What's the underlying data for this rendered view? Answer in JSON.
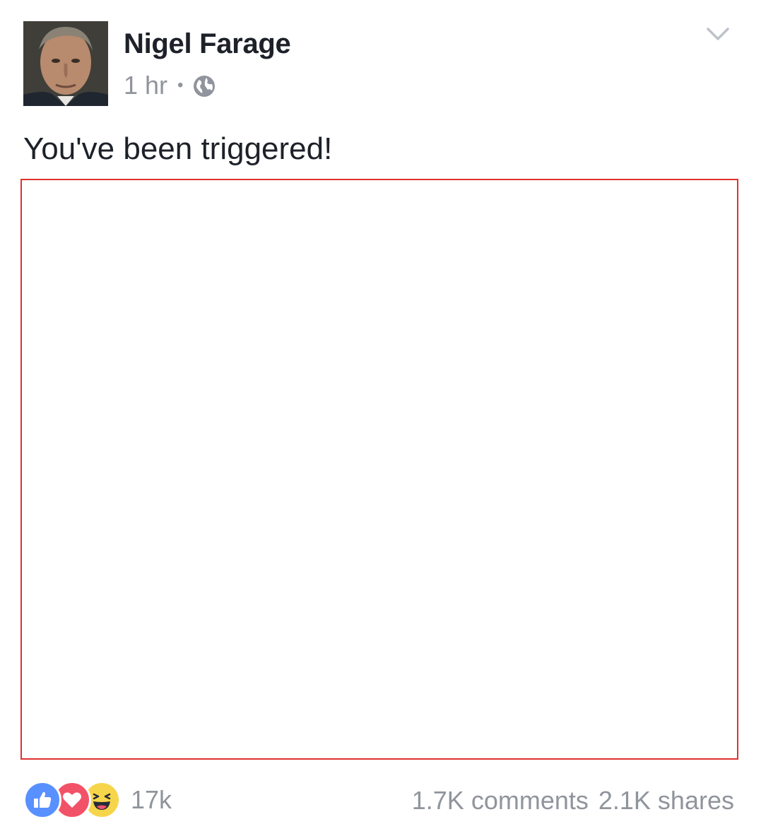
{
  "post": {
    "author": "Nigel Farage",
    "timestamp": "1 hr",
    "separator": "•",
    "privacy_icon": "globe-icon",
    "menu_icon": "chevron-down-icon",
    "text": "You've been triggered!",
    "media_border_color": "#e0312f"
  },
  "footer": {
    "reactions": [
      {
        "type": "like",
        "icon": "like-reaction-icon",
        "color": "#5890ff"
      },
      {
        "type": "love",
        "icon": "love-reaction-icon",
        "color": "#f25268"
      },
      {
        "type": "haha",
        "icon": "haha-reaction-icon",
        "color": "#f7d54b"
      }
    ],
    "reaction_count": "17k",
    "comments": "1.7K comments",
    "shares": "2.1K shares"
  }
}
